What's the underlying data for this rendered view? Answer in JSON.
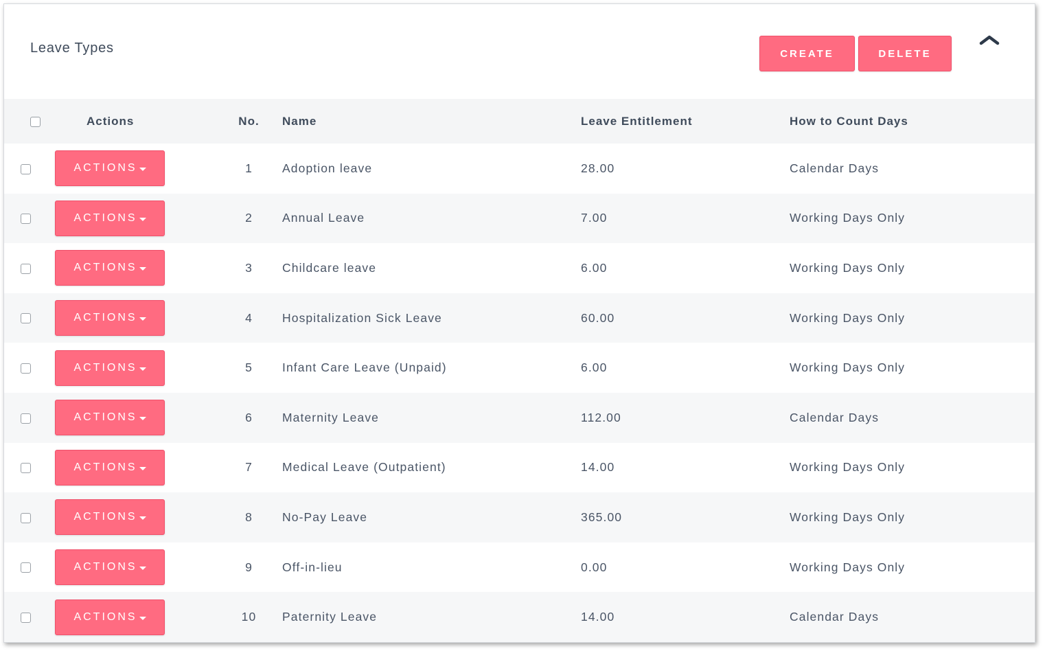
{
  "panel": {
    "title": "Leave Types",
    "create_label": "CREATE",
    "delete_label": "DELETE",
    "collapse_icon": "chevron-up-icon"
  },
  "table": {
    "headers": {
      "actions": "Actions",
      "no": "No.",
      "name": "Name",
      "entitlement": "Leave Entitlement",
      "count": "How to Count Days"
    },
    "action_label": "ACTIONS",
    "rows": [
      {
        "no": "1",
        "name": "Adoption leave",
        "entitlement": "28.00",
        "count": "Calendar Days"
      },
      {
        "no": "2",
        "name": "Annual Leave",
        "entitlement": "7.00",
        "count": "Working Days Only"
      },
      {
        "no": "3",
        "name": "Childcare leave",
        "entitlement": "6.00",
        "count": "Working Days Only"
      },
      {
        "no": "4",
        "name": "Hospitalization Sick Leave",
        "entitlement": "60.00",
        "count": "Working Days Only"
      },
      {
        "no": "5",
        "name": "Infant Care Leave (Unpaid)",
        "entitlement": "6.00",
        "count": "Working Days Only"
      },
      {
        "no": "6",
        "name": "Maternity Leave",
        "entitlement": "112.00",
        "count": "Calendar Days"
      },
      {
        "no": "7",
        "name": "Medical Leave (Outpatient)",
        "entitlement": "14.00",
        "count": "Working Days Only"
      },
      {
        "no": "8",
        "name": "No-Pay Leave",
        "entitlement": "365.00",
        "count": "Working Days Only"
      },
      {
        "no": "9",
        "name": "Off-in-lieu",
        "entitlement": "0.00",
        "count": "Working Days Only"
      },
      {
        "no": "10",
        "name": "Paternity Leave",
        "entitlement": "14.00",
        "count": "Calendar Days"
      }
    ]
  },
  "colors": {
    "accent": "#ff6b81",
    "text": "#3f4b5b",
    "stripe": "#f6f7f8"
  }
}
